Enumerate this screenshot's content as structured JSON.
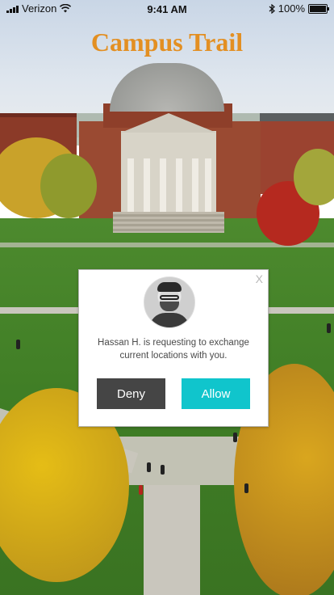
{
  "status_bar": {
    "carrier": "Verizon",
    "time": "9:41 AM",
    "battery": "100%",
    "icons": [
      "signal-icon",
      "wifi-icon",
      "bluetooth-icon",
      "battery-icon"
    ]
  },
  "app": {
    "title": "Campus Trail",
    "title_color": "#e38f22"
  },
  "dialog": {
    "close_label": "X",
    "avatar_icon": "user-avatar-photo",
    "message": "Hassan H. is requesting to exchange current locations with you.",
    "deny_label": "Deny",
    "allow_label": "Allow",
    "deny_color": "#454545",
    "allow_color": "#10c5cc"
  }
}
